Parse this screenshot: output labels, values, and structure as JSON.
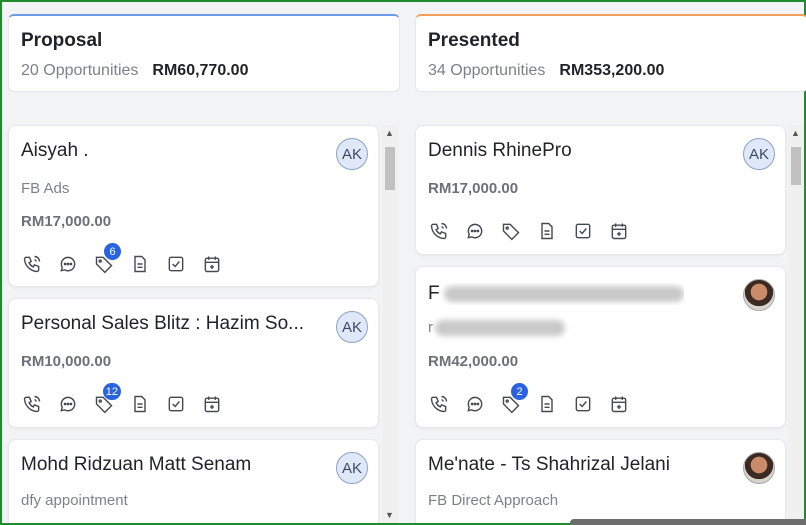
{
  "stages": [
    {
      "title": "Proposal",
      "count": "20 Opportunities",
      "value": "RM60,770.00",
      "accent": "#6c9ae8"
    },
    {
      "title": "Presented",
      "count": "34 Opportunities",
      "value": "RM353,200.00",
      "accent": "#f2a05a"
    }
  ],
  "proposal_cards": [
    {
      "name": "Aisyah .",
      "source": "FB Ads",
      "amount": "RM17,000.00",
      "avatar": "AK",
      "tag_count": "6"
    },
    {
      "name": "Personal Sales Blitz : Hazim So...",
      "amount": "RM10,000.00",
      "avatar": "AK",
      "tag_count": "12"
    },
    {
      "name": "Mohd Ridzuan Matt Senam",
      "source": "dfy appointment",
      "avatar": "AK"
    }
  ],
  "presented_cards": [
    {
      "name": "Dennis RhinePro",
      "amount": "RM17,000.00",
      "avatar": "AK"
    },
    {
      "name_initial": "F",
      "amount": "RM42,000.00",
      "tag_count": "2",
      "source_initial": "r"
    },
    {
      "name": "Me'nate - Ts Shahrizal Jelani",
      "source": "FB Direct Approach"
    }
  ],
  "icons": [
    "phone-icon",
    "chat-icon",
    "tag-icon",
    "document-icon",
    "checkbox-icon",
    "calendar-add-icon"
  ],
  "colors": {
    "badge": "#2a62e0",
    "border": "#1f8a2e"
  }
}
